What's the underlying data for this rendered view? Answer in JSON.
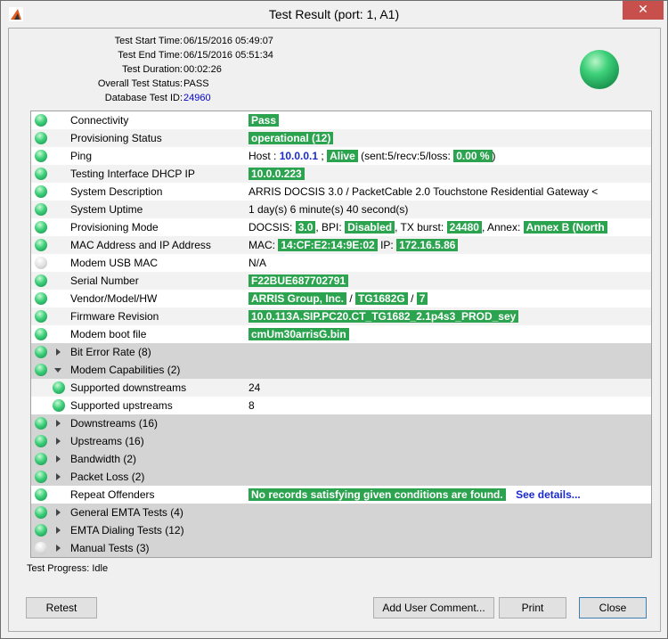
{
  "window": {
    "title": "Test Result (port: 1, A1)",
    "close_glyph": "✕"
  },
  "summary": [
    {
      "label": "Test Start Time:",
      "value": "06/15/2016 05:49:07"
    },
    {
      "label": "Test End Time:",
      "value": "06/15/2016 05:51:34"
    },
    {
      "label": "Test Duration:",
      "value": "00:02:26"
    },
    {
      "label": "Overall Test Status:",
      "value": "PASS"
    },
    {
      "label": "Database Test ID:",
      "value": "24960"
    }
  ],
  "rows": {
    "connectivity": {
      "name": "Connectivity",
      "value": "Pass"
    },
    "provisioning_status": {
      "name": "Provisioning Status",
      "value": "operational (12)"
    },
    "ping": {
      "name": "Ping",
      "host_label": "Host :",
      "host": "10.0.0.1",
      "sep": ";",
      "alive": "Alive",
      "stats": "(sent:5/recv:5/loss:",
      "loss": "0.00 %",
      "close": ")"
    },
    "dhcp": {
      "name": "Testing Interface DHCP IP",
      "value": "10.0.0.223"
    },
    "sysdesc": {
      "name": "System Description",
      "value": "ARRIS DOCSIS 3.0 / PacketCable 2.0 Touchstone Residential Gateway <"
    },
    "uptime": {
      "name": "System Uptime",
      "value": "1 day(s) 6 minute(s) 40 second(s)"
    },
    "provmode": {
      "name": "Provisioning Mode",
      "docsis_label": "DOCSIS:",
      "docsis": "3.0",
      "bpi_label": ", BPI:",
      "bpi": "Disabled",
      "tx_label": ", TX burst:",
      "tx": "24480",
      "annex_label": ", Annex:",
      "annex": "Annex B (North"
    },
    "macip": {
      "name": "MAC Address and IP Address",
      "mac_label": "MAC:",
      "mac": "14:CF:E2:14:9E:02",
      "ip_label": "IP:",
      "ip": "172.16.5.86"
    },
    "usbmac": {
      "name": "Modem USB MAC",
      "value": "N/A"
    },
    "serial": {
      "name": "Serial Number",
      "value": "F22BUE687702791"
    },
    "vendor": {
      "name": "Vendor/Model/HW",
      "vendor": "ARRIS Group, Inc.",
      "sep1": "/",
      "model": "TG1682G",
      "sep2": "/",
      "hw": "7"
    },
    "firmware": {
      "name": "Firmware Revision",
      "value": "10.0.113A.SIP.PC20.CT_TG1682_2.1p4s3_PROD_sey"
    },
    "bootfile": {
      "name": "Modem boot file",
      "value": "cmUm30arrisG.bin"
    },
    "ber": {
      "name": "Bit Error Rate (8)"
    },
    "modemcaps": {
      "name": "Modem Capabilities (2)"
    },
    "downstreams_sup": {
      "name": "Supported downstreams",
      "value": "24"
    },
    "upstreams_sup": {
      "name": "Supported upstreams",
      "value": "8"
    },
    "downstreams": {
      "name": "Downstreams (16)"
    },
    "upstreams": {
      "name": "Upstreams (16)"
    },
    "bandwidth": {
      "name": "Bandwidth (2)"
    },
    "packetloss": {
      "name": "Packet Loss (2)"
    },
    "repeat": {
      "name": "Repeat Offenders",
      "value": "No records satisfying given conditions are found.",
      "link": "See details..."
    },
    "emta": {
      "name": "General EMTA Tests (4)"
    },
    "emtadial": {
      "name": "EMTA Dialing Tests (12)"
    },
    "manual": {
      "name": "Manual Tests (3)"
    }
  },
  "progress": "Test Progress: Idle",
  "buttons": {
    "retest": "Retest",
    "comment": "Add User Comment...",
    "print": "Print",
    "close": "Close"
  },
  "colors": {
    "pass_green": "#2ba34f",
    "link_blue": "#1a2bcc",
    "close_red": "#c7504c"
  }
}
